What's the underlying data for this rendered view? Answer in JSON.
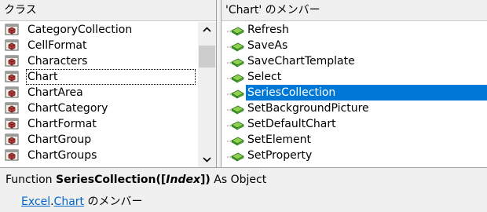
{
  "left_pane": {
    "header": "クラス",
    "classes": [
      {
        "label": "CategoryCollection",
        "focused": false
      },
      {
        "label": "CellFormat",
        "focused": false
      },
      {
        "label": "Characters",
        "focused": false
      },
      {
        "label": "Chart",
        "focused": true
      },
      {
        "label": "ChartArea",
        "focused": false
      },
      {
        "label": "ChartCategory",
        "focused": false
      },
      {
        "label": "ChartFormat",
        "focused": false
      },
      {
        "label": "ChartGroup",
        "focused": false
      },
      {
        "label": "ChartGroups",
        "focused": false
      }
    ]
  },
  "right_pane": {
    "header": "'Chart' のメンバー",
    "members": [
      {
        "label": "Refresh",
        "selected": false
      },
      {
        "label": "SaveAs",
        "selected": false
      },
      {
        "label": "SaveChartTemplate",
        "selected": false
      },
      {
        "label": "Select",
        "selected": false
      },
      {
        "label": "SeriesCollection",
        "selected": true
      },
      {
        "label": "SetBackgroundPicture",
        "selected": false
      },
      {
        "label": "SetDefaultChart",
        "selected": false
      },
      {
        "label": "SetElement",
        "selected": false
      },
      {
        "label": "SetProperty",
        "selected": false
      }
    ]
  },
  "details": {
    "keyword": "Function ",
    "member_name": "SeriesCollection",
    "open_paren": "([",
    "param": "Index",
    "close_paren": "])",
    "returns": " As Object",
    "library_link": "Excel",
    "separator": ".",
    "class_link": "Chart",
    "member_of_suffix": " のメンバー"
  },
  "icons": {
    "class_icon": "class-module-icon",
    "method_icon": "method-icon",
    "scroll_up": "scroll-up-arrow-icon",
    "scroll_down": "scroll-down-arrow-icon"
  },
  "colors": {
    "selection": "#0078d7",
    "link": "#0066cc",
    "method_green": "#3a9a2c"
  }
}
